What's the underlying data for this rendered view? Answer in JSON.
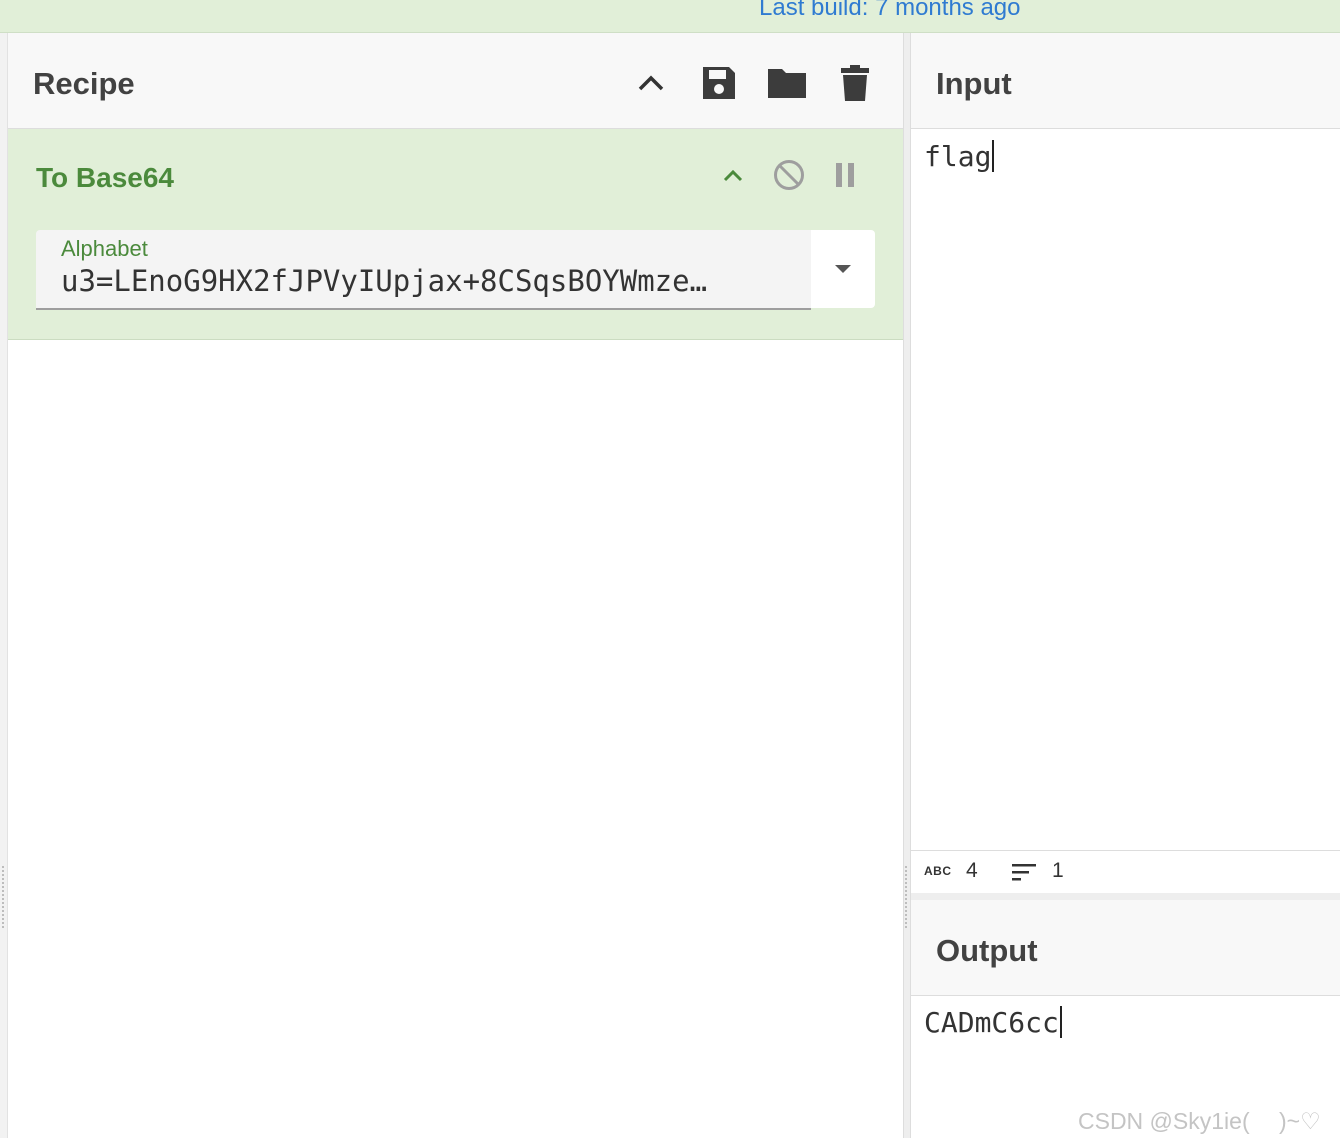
{
  "banner": {
    "last_build": "Last build: 7 months ago"
  },
  "recipe": {
    "title": "Recipe",
    "icons": {
      "collapse": "chevron-up-icon",
      "save": "save-icon",
      "load": "folder-icon",
      "clear": "trash-icon"
    },
    "operation": {
      "name": "To Base64",
      "icons": {
        "collapse": "chevron-up-icon",
        "disable": "disable-icon",
        "breakpoint": "pause-icon"
      },
      "alphabet_label": "Alphabet",
      "alphabet_segments": [
        "u3=",
        "LEnoG9HX2fJPVyIUpjax",
        "+8",
        "CSqsBOYWmze",
        "…"
      ]
    }
  },
  "input": {
    "title": "Input",
    "text": "flag",
    "stats": {
      "abc_label": "ABC",
      "length": "4",
      "lines": "1"
    }
  },
  "output": {
    "title": "Output",
    "text": "CADmC6cc"
  },
  "watermark": "CSDN @Sky1ie(　 )~♡",
  "colors": {
    "accent_green": "#4b8a3c",
    "op_background": "#e1efd8",
    "link_blue": "#2f7bd1"
  }
}
